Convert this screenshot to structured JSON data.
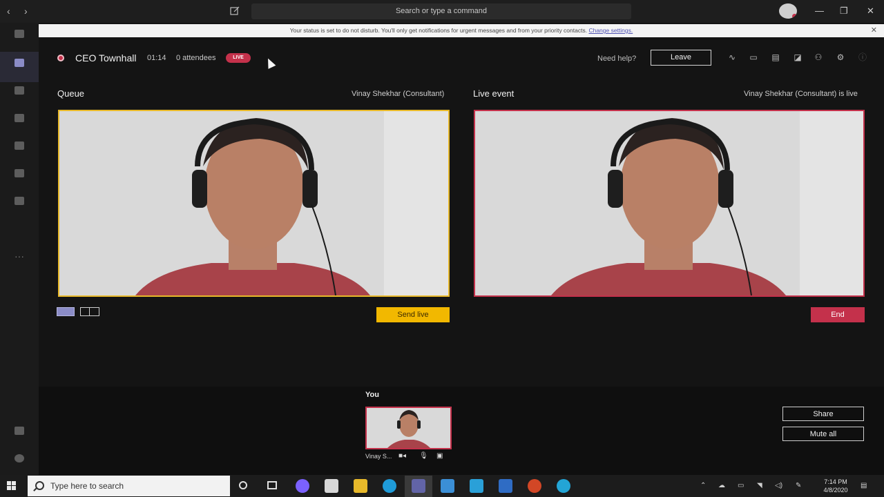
{
  "titlebar": {
    "search_placeholder": "Search or type a command",
    "back_icon": "‹",
    "forward_icon": "›",
    "minimize": "—",
    "maximize": "❐",
    "close": "✕"
  },
  "banner": {
    "text": "Your status is set to do not disturb. You'll only get notifications for urgent messages and from your priority contacts.",
    "link": "Change settings.",
    "close": "✕"
  },
  "meeting": {
    "title": "CEO Townhall",
    "elapsed": "01:14",
    "attendees": "0 attendees",
    "live_badge": "LIVE",
    "need_help": "Need help?",
    "leave": "Leave"
  },
  "queue": {
    "label": "Queue",
    "presenter": "Vinay Shekhar (Consultant)",
    "send_live": "Send live"
  },
  "live_event": {
    "label": "Live event",
    "status": "Vinay Shekhar (Consultant) is live",
    "end": "End"
  },
  "self_view": {
    "label": "You",
    "name": "Vinay S..."
  },
  "side_actions": {
    "share": "Share",
    "mute_all": "Mute all"
  },
  "taskbar": {
    "search_placeholder": "Type here to search",
    "time": "7:14 PM",
    "date": "4/8/2020"
  },
  "colors": {
    "accent": "#8b8cc7",
    "live_red": "#c4314b",
    "queue_yellow": "#e8b92a",
    "send_live": "#f2b800"
  }
}
